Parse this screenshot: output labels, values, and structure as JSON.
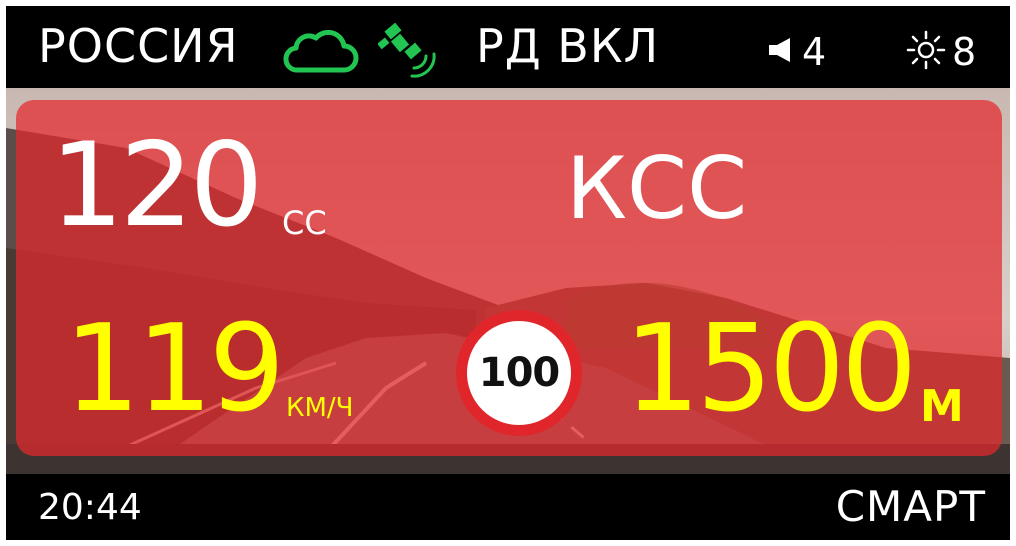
{
  "status_bar": {
    "region": "РОССИЯ",
    "cloud_icon": "cloud-icon",
    "satellite_icon": "gps-satellite-icon",
    "mode": "РД ВКЛ",
    "volume_icon": "speaker-icon",
    "volume": "4",
    "brightness_icon": "sun-icon",
    "brightness": "8",
    "status_color": "#23c552"
  },
  "alert": {
    "speed_limit": "120",
    "speed_limit_unit": "СС",
    "camera_type": "КСС",
    "current_speed": "119",
    "current_speed_unit": "КМ/Ч",
    "sign_value": "100",
    "distance": "1500",
    "distance_unit": "М",
    "panel_color": "#e4282c",
    "value_color": "#ffff00"
  },
  "bottom_bar": {
    "time": "20:44",
    "profile": "СМАРТ"
  }
}
